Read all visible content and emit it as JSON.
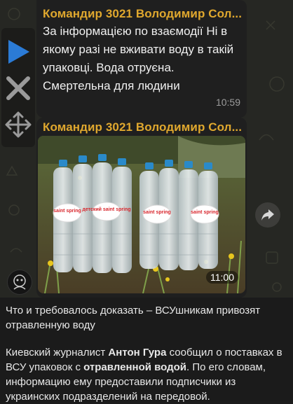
{
  "message1": {
    "sender": "Командир 3021 Володимир Сол...",
    "text": "За інформацією по взаємодії Ні в якому разі не вживати воду в такій упаковці.  Вода отруєна. Смертельна для людини",
    "time": "10:59"
  },
  "message2": {
    "sender": "Командир 3021 Володимир Сол...",
    "time": "11:00",
    "photo": {
      "label": "saint spring",
      "label_alt": "детский saint spring"
    }
  },
  "controls": {
    "play_icon": "play-icon",
    "close_icon": "close-x-icon",
    "move_icon": "move-arrows-icon",
    "play_color": "#2b7bd6"
  },
  "share_icon": "share-forward-icon",
  "post": {
    "title": "Что и требовалось доказать – ВСУшникам привозят отравленную воду",
    "body_p1": "Киевский журналист ",
    "body_name": "Антон Гура",
    "body_p2": " сообщил о поставках в ВСУ упаковок с ",
    "body_bold2": "отравленной водой",
    "body_p3": ". По его словам, информацию ему предоставили подписчики из украинских подразделений на передовой."
  },
  "colors": {
    "sender": "#e0a82e",
    "bubble": "#1f1f1f",
    "chat_bg": "#262723",
    "post_bg": "#1b1b1b"
  }
}
